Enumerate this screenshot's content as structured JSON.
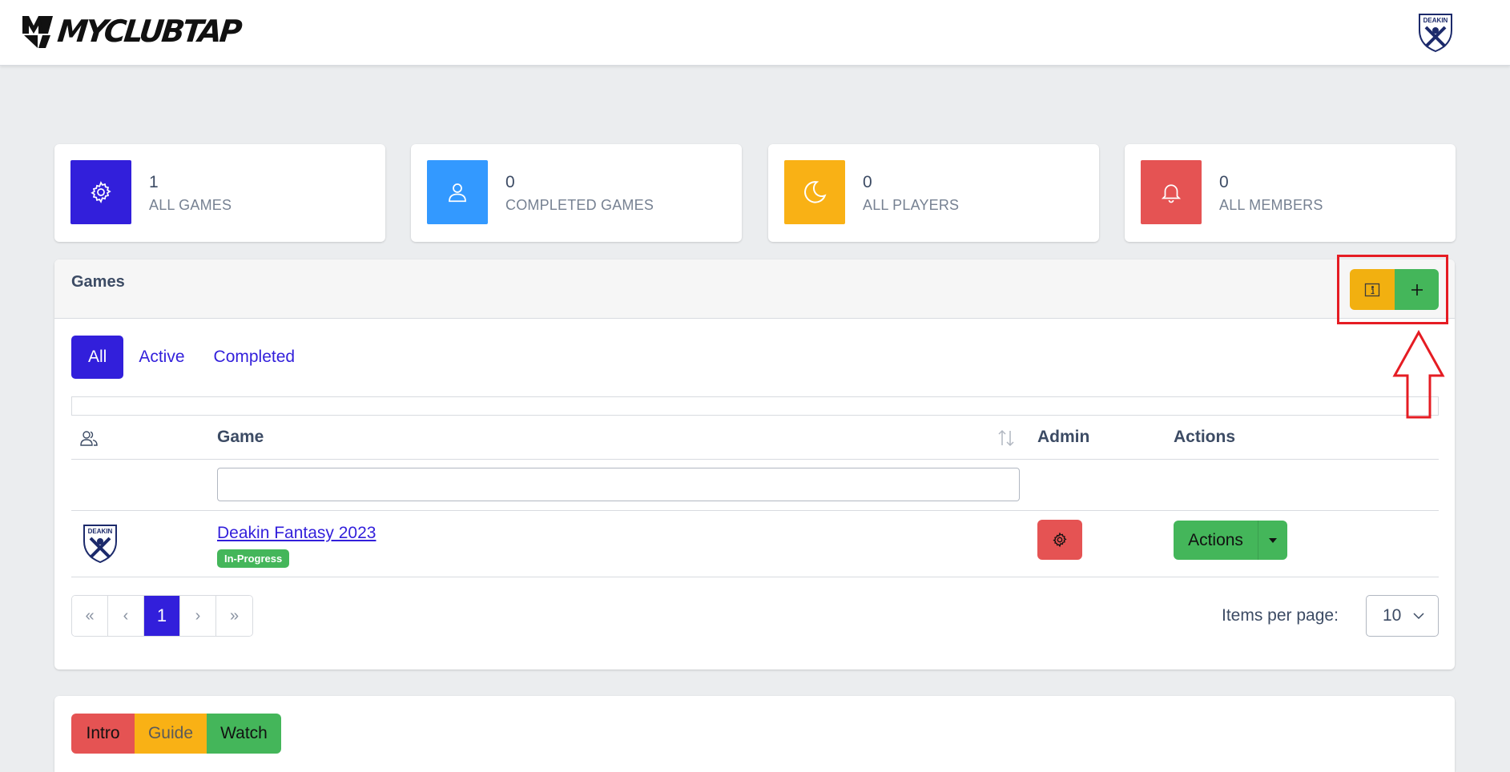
{
  "header": {
    "logo_text": "MYCLUBTAP",
    "club_logo": "deakin-logo",
    "club_logo_text": "DEAKIN"
  },
  "stats": [
    {
      "value": "1",
      "label": "ALL GAMES",
      "icon": "gear-icon",
      "color": "#321fdb"
    },
    {
      "value": "0",
      "label": "COMPLETED GAMES",
      "icon": "user-icon",
      "color": "#3399ff"
    },
    {
      "value": "0",
      "label": "ALL PLAYERS",
      "icon": "moon-icon",
      "color": "#f9b115"
    },
    {
      "value": "0",
      "label": "ALL MEMBERS",
      "icon": "bell-icon",
      "color": "#e55353"
    }
  ],
  "games": {
    "title": "Games",
    "header_buttons": {
      "info_icon": "info-icon",
      "add_icon": "plus-icon",
      "info_color": "#f9b115",
      "add_color": "#2eb85c"
    },
    "tabs": [
      {
        "label": "All",
        "active": true
      },
      {
        "label": "Active",
        "active": false
      },
      {
        "label": "Completed",
        "active": false
      }
    ],
    "columns": {
      "players_icon": "users-icon",
      "game": "Game",
      "admin": "Admin",
      "actions": "Actions"
    },
    "filter": {
      "value": "",
      "placeholder": ""
    },
    "rows": [
      {
        "logo": "deakin-logo",
        "logo_text": "DEAKIN",
        "name": "Deakin Fantasy 2023",
        "status": "In-Progress",
        "admin_icon": "gear-icon",
        "actions_label": "Actions"
      }
    ],
    "pagination": {
      "first": "«",
      "prev": "‹",
      "current": "1",
      "next": "›",
      "last": "»"
    },
    "items_per_page": {
      "label": "Items per page:",
      "value": "10"
    }
  },
  "annotation": {
    "color": "#e51c23"
  },
  "help_buttons": {
    "intro": "Intro",
    "guide": "Guide",
    "watch": "Watch"
  }
}
